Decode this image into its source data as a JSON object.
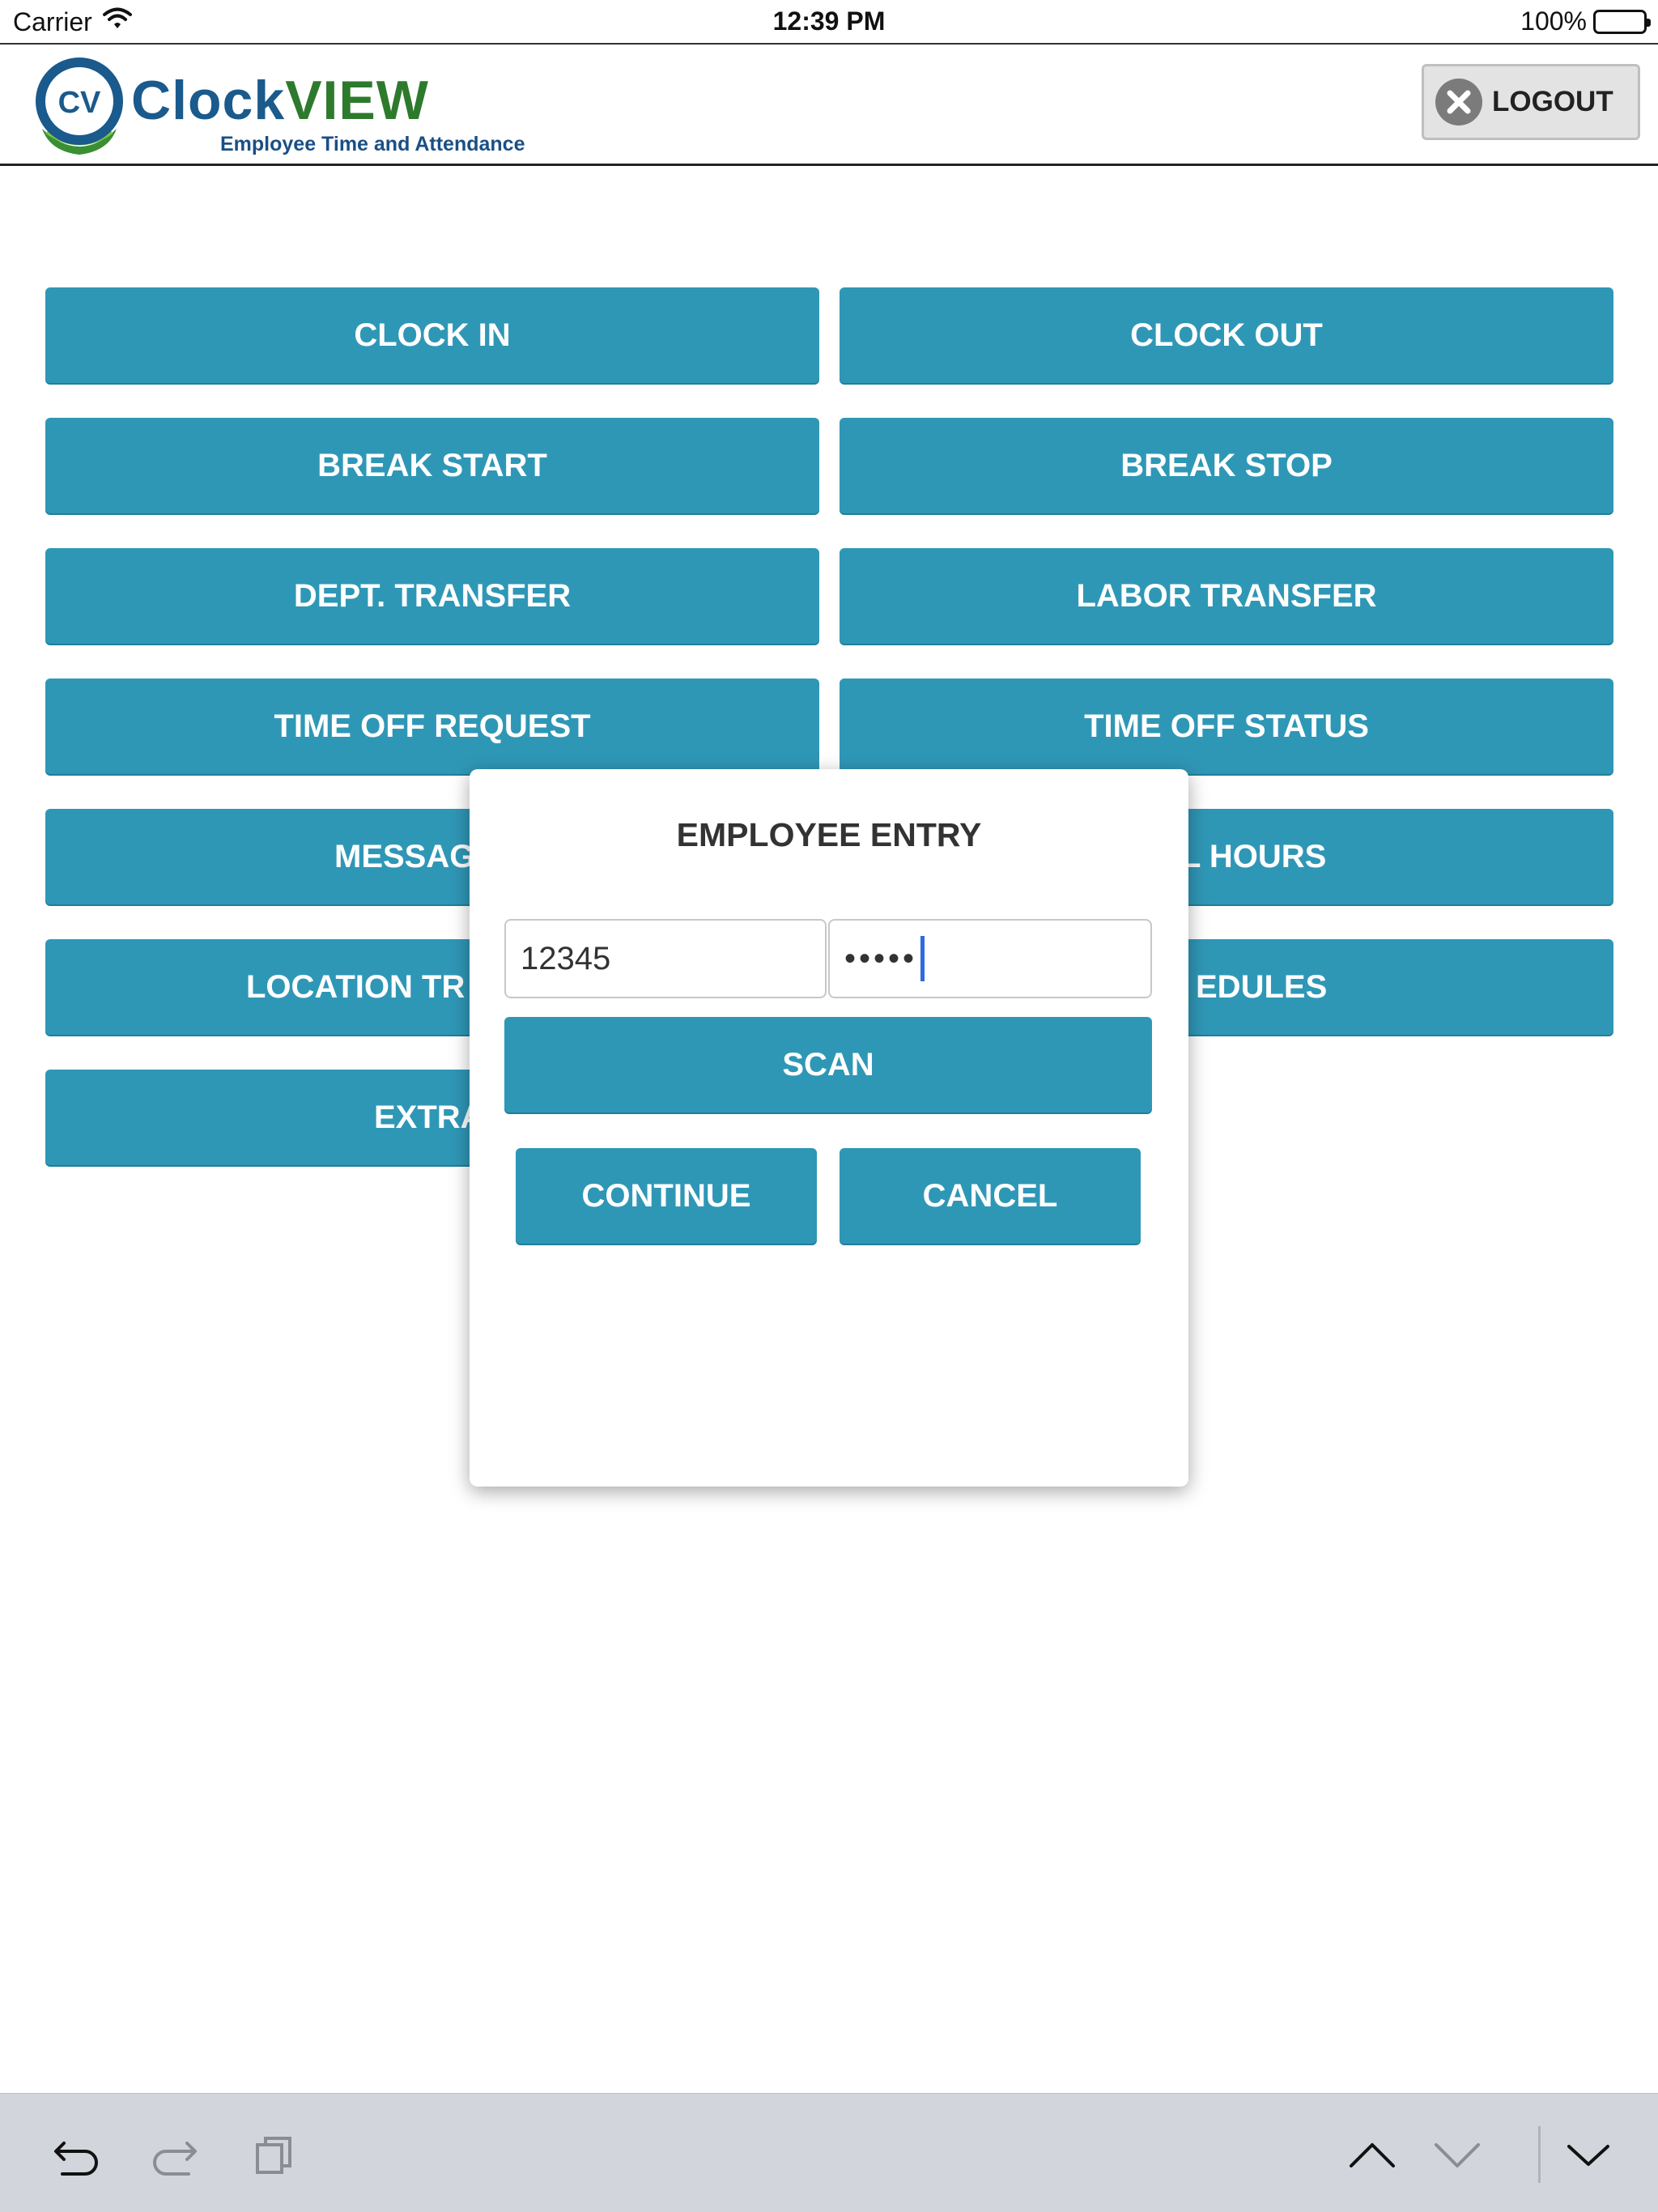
{
  "status_bar": {
    "carrier": "Carrier",
    "time": "12:39 PM",
    "battery": "100%"
  },
  "header": {
    "logo_badge": "CV",
    "logo_word_clock": "Clock",
    "logo_word_view": "VIEW",
    "logo_tagline": "Employee Time and Attendance",
    "logout_label": "LOGOUT"
  },
  "menu": {
    "clock_in": "CLOCK IN",
    "clock_out": "CLOCK OUT",
    "break_start": "BREAK START",
    "break_stop": "BREAK STOP",
    "dept_transfer": "DEPT. TRANSFER",
    "labor_transfer": "LABOR TRANSFER",
    "time_off_request": "TIME OFF REQUEST",
    "time_off_status": "TIME OFF STATUS",
    "messages_partial": "MESSAG",
    "hours_partial": "L HOURS",
    "location_partial": "LOCATION TR",
    "schedules_partial": "EDULES",
    "extra_partial": "EXTRA"
  },
  "modal": {
    "title": "EMPLOYEE ENTRY",
    "employee_id_value": "12345",
    "pin_value": "•••••",
    "scan_label": "SCAN",
    "continue_label": "CONTINUE",
    "cancel_label": "CANCEL"
  },
  "keyboard_bar": {
    "icons": [
      "undo-icon",
      "redo-icon",
      "clipboard-icon",
      "chevron-up-icon",
      "chevron-down-icon",
      "keyboard-dismiss-icon"
    ]
  },
  "colors": {
    "button": "#2f97b6",
    "brand_blue": "#1a5a8c",
    "brand_green": "#2d7a2d",
    "caret": "#2d6be0"
  }
}
